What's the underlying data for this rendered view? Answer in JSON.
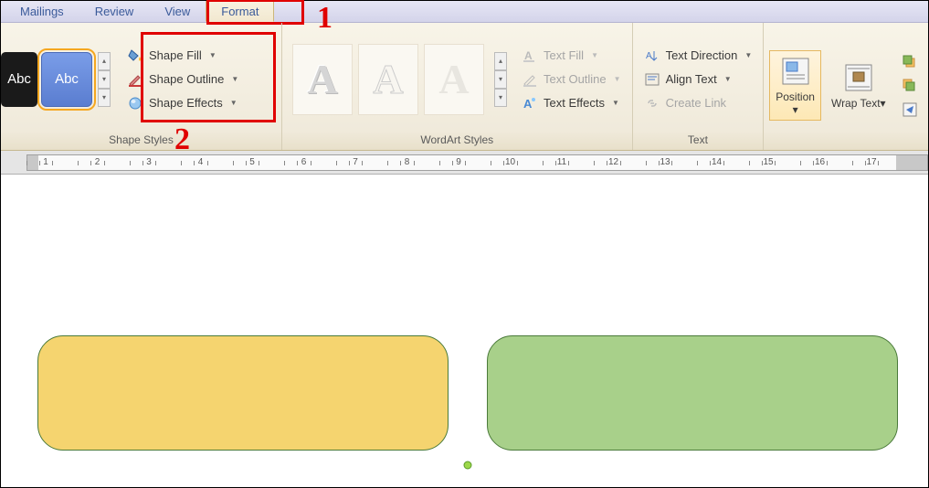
{
  "tabs": [
    {
      "label": "Mailings",
      "active": false
    },
    {
      "label": "Review",
      "active": false
    },
    {
      "label": "View",
      "active": false
    },
    {
      "label": "Format",
      "active": true
    }
  ],
  "shape_styles": {
    "preview_abc": "Abc",
    "group_label": "Shape Styles",
    "fill_label": "Shape Fill",
    "outline_label": "Shape Outline",
    "effects_label": "Shape Effects"
  },
  "wordart_styles": {
    "preview_letter": "A",
    "group_label": "WordArt Styles",
    "text_fill_label": "Text Fill",
    "text_outline_label": "Text Outline",
    "text_effects_label": "Text Effects"
  },
  "text_group": {
    "direction_label": "Text Direction",
    "align_label": "Align Text",
    "link_label": "Create Link",
    "group_label": "Text"
  },
  "arrange": {
    "position_label": "Position",
    "wrap_label": "Wrap Text"
  },
  "callouts": {
    "one": "1",
    "two": "2"
  },
  "ruler": {
    "numbers": [
      1,
      2,
      3,
      4,
      5,
      6,
      7,
      8,
      9,
      10,
      11,
      12,
      13,
      14,
      15,
      16,
      17
    ]
  }
}
